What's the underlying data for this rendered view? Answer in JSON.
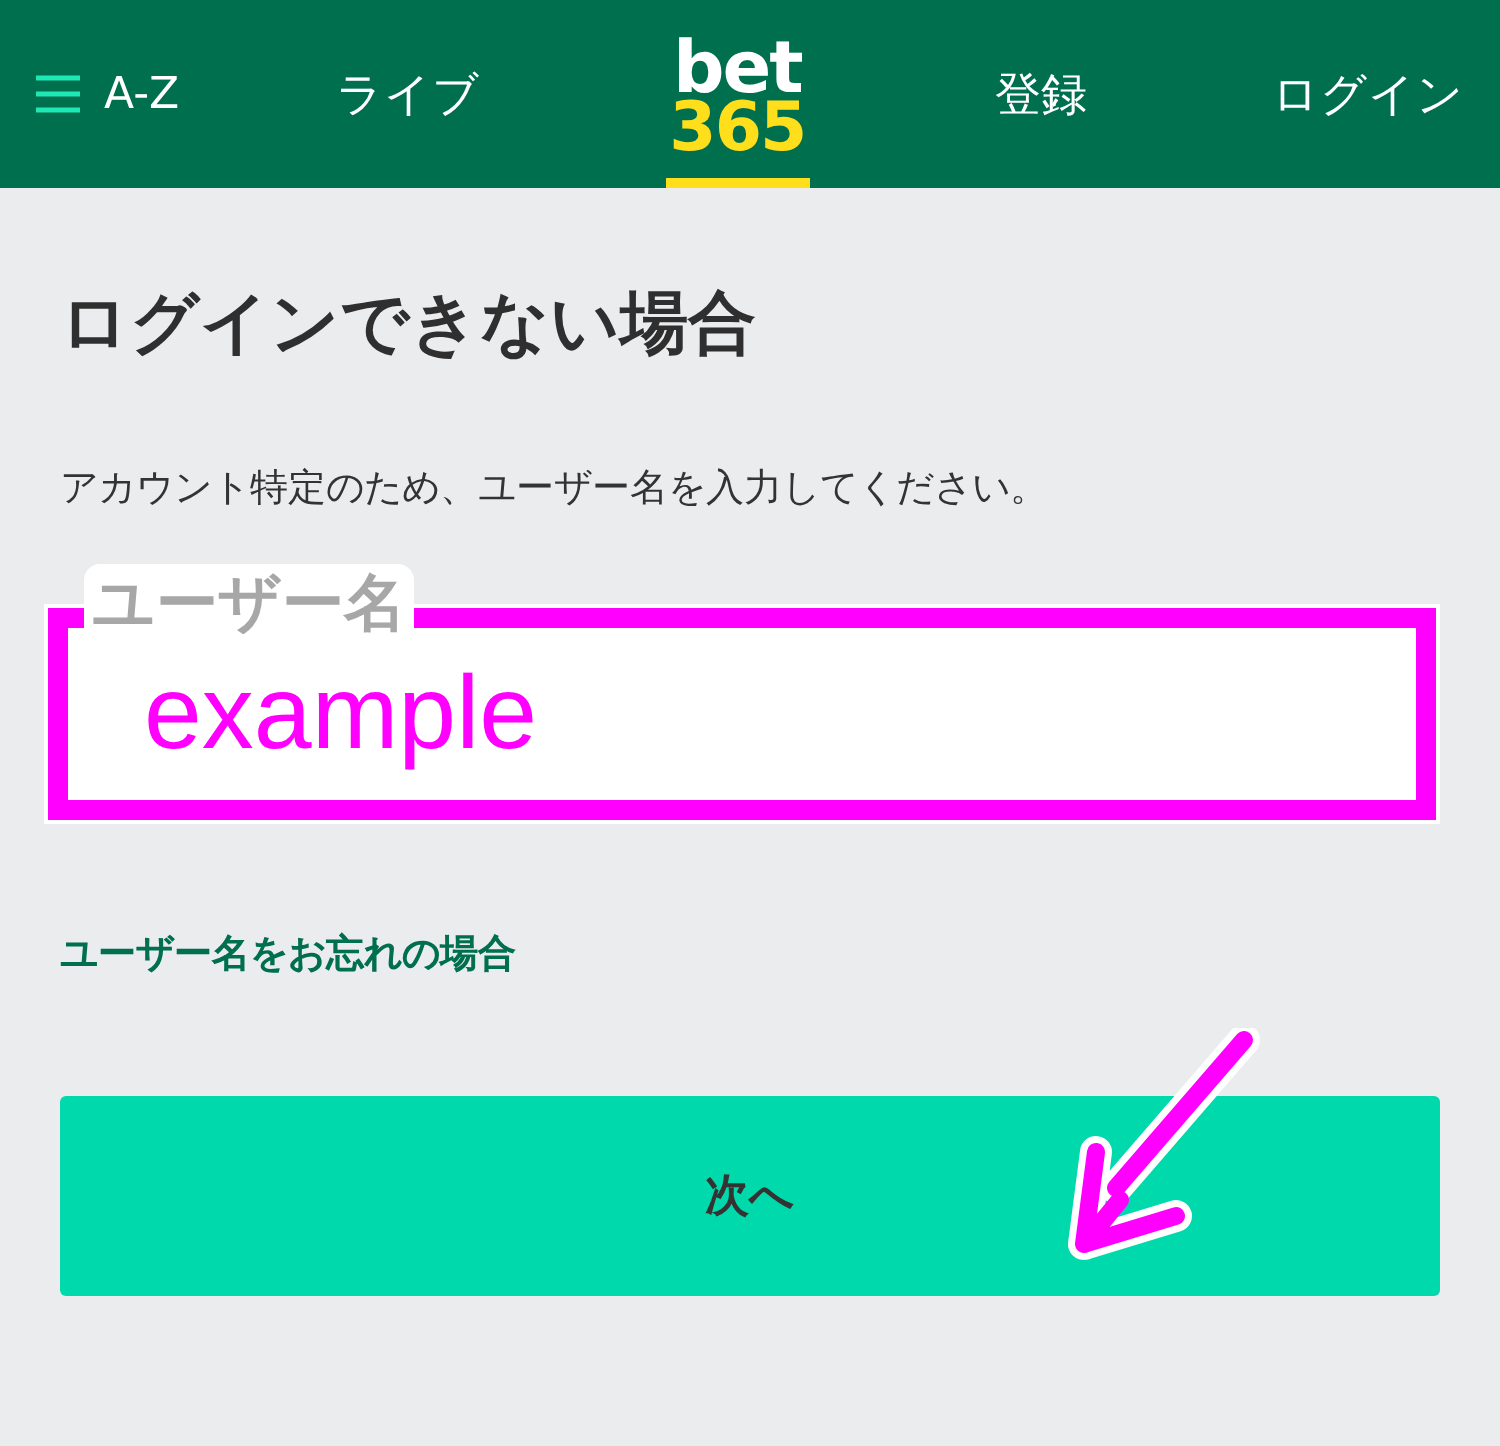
{
  "header": {
    "menu_label": "A-Z",
    "nav": [
      {
        "kind": "text",
        "label": "ライブ",
        "selected": false
      },
      {
        "kind": "logo",
        "lines": [
          "bet",
          "365"
        ],
        "selected": true
      },
      {
        "kind": "text",
        "label": "登録",
        "selected": false
      },
      {
        "kind": "text",
        "label": "ログイン",
        "selected": false
      }
    ]
  },
  "title": "ログインできない場合",
  "description": "アカウント特定のため、ユーザー名を入力してください。",
  "username_field": {
    "label": "ユーザー名",
    "value": "example",
    "highlighted": true
  },
  "forgot_link": "ユーザー名をお忘れの場合",
  "next_button": "次へ"
}
